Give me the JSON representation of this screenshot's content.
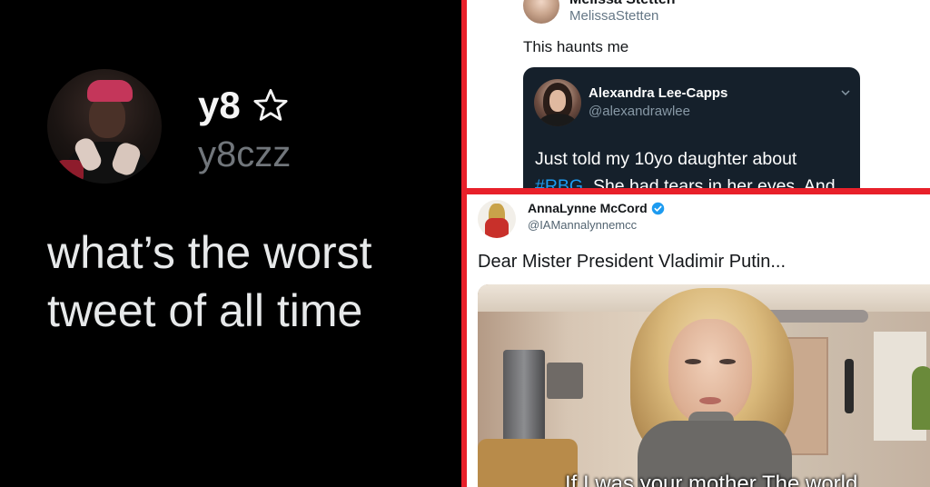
{
  "main_tweet": {
    "display_name": "y8",
    "handle": "y8czz",
    "text": "what’s the worst tweet of all time",
    "name_icon": "star-outline-icon"
  },
  "top_right_tweet": {
    "display_name": "Melissa Stetten",
    "handle": "MelissaStetten",
    "text": "This haunts me",
    "quoted": {
      "display_name": "Alexandra Lee-Capps",
      "handle": "@alexandrawlee",
      "text_before": "Just told my 10yo daughter about ",
      "hashtag": "#RBG",
      "text_after": ". She had tears in her eyes. And",
      "menu_icon": "chevron-down-icon",
      "background": "#15202b"
    }
  },
  "bottom_right_tweet": {
    "display_name": "AnnaLynne McCord",
    "handle": "@IAMannalynnemcc",
    "verified_icon": "verified-badge-icon",
    "text": "Dear Mister President Vladimir Putin...",
    "video_caption": "If I was your mother The world"
  },
  "colors": {
    "divider": "#e8202a",
    "hashtag": "#1d9bf0",
    "verified": "#1d9bf0"
  }
}
